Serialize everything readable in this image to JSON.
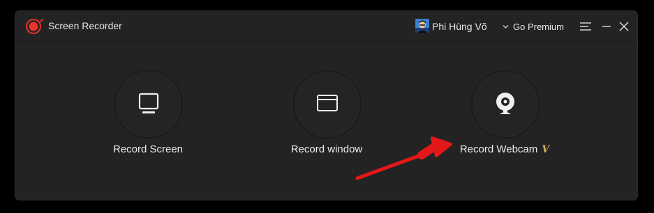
{
  "window": {
    "app_title": "Screen Recorder",
    "icons": {
      "logo": "record-logo-icon",
      "premium_chevron": "chevron-down-icon",
      "menu": "menu-icon",
      "minimize": "minimize-icon",
      "close": "close-icon"
    }
  },
  "account": {
    "username": "Phi Hùng Võ",
    "premium_label": "Go Premium"
  },
  "modes": [
    {
      "label": "Record Screen",
      "icon": "monitor-icon"
    },
    {
      "label": "Record window",
      "icon": "window-icon"
    },
    {
      "label": "Record Webcam",
      "icon": "webcam-icon",
      "badge": "V"
    }
  ],
  "colors": {
    "background": "#232323",
    "accent_red": "#e8332b",
    "vip_gold": "#d8a860",
    "annotation_arrow": "#e41818"
  }
}
